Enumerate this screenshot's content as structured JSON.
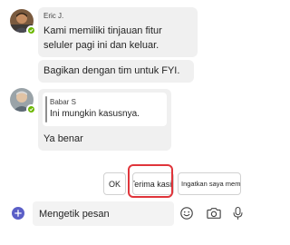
{
  "messages": [
    {
      "sender": "Eric J.",
      "avatar_icon": "person-photo-icon",
      "presence": "available",
      "lines": [
        "Kami memiliki tinjauan fitur",
        "seluler pagi ini dan keluar."
      ]
    },
    {
      "text": "Bagikan dengan tim untuk FYI."
    },
    {
      "sender": "Babar S",
      "avatar_icon": "person-photo-icon",
      "presence": "available",
      "quote": "Ini mungkin kasusnya.",
      "text": "Ya benar"
    }
  ],
  "suggested_replies": [
    "OK",
    "Terima kasih",
    "Ingatkan saya memeriksa"
  ],
  "composer": {
    "placeholder": "Mengetik pesan",
    "icons": [
      "add-icon",
      "emoji-icon",
      "camera-icon",
      "microphone-icon"
    ]
  },
  "colors": {
    "bubble": "#f0f0f0",
    "presence": "#6bb700",
    "highlight": "#e0353b",
    "accent": "#5b5fc7"
  }
}
